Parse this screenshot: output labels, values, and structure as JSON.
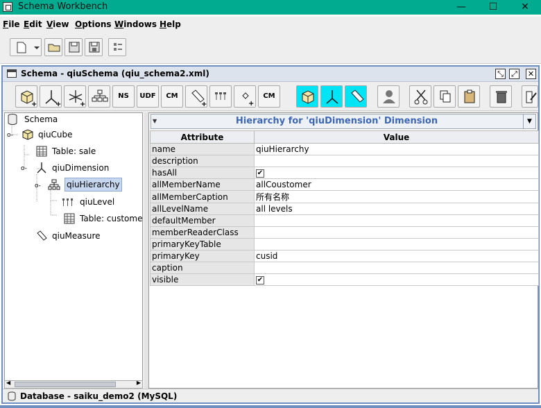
{
  "window": {
    "title": "Schema Workbench",
    "minimize": "—",
    "maximize": "☐",
    "close": "✕"
  },
  "menu": [
    {
      "first": "F",
      "rest": "ile"
    },
    {
      "first": "E",
      "rest": "dit"
    },
    {
      "first": "V",
      "rest": "iew"
    },
    {
      "first": "O",
      "rest": "ptions"
    },
    {
      "first": "W",
      "rest": "indows"
    },
    {
      "first": "H",
      "rest": "elp"
    }
  ],
  "inner_window": {
    "title": "Schema - qiuSchema (qiu_schema2.xml)"
  },
  "toolbar": {
    "buttons": [
      "cube",
      "dimension",
      "dimension-usage",
      "hierarchy",
      "NS",
      "UDF",
      "CM",
      "measure",
      "level",
      "property",
      "CM",
      "cube",
      "dimension",
      "measure",
      "role",
      "cut",
      "copy",
      "paste",
      "delete",
      "edit"
    ],
    "ns_label": "NS",
    "udf_label": "UDF",
    "cm_label": "CM",
    "cm2_label": "CM"
  },
  "tree": {
    "root": "Schema",
    "cube": "qiuCube",
    "table1": "Table: sale",
    "dimension": "qiuDimension",
    "hierarchy": "qiuHierarchy",
    "level": "qiuLevel",
    "table2": "Table: customer",
    "measure": "qiuMeasure"
  },
  "editor": {
    "heading": "Hierarchy for 'qiuDimension' Dimension",
    "col_attribute": "Attribute",
    "col_value": "Value",
    "rows": [
      {
        "attr": "name",
        "value": "qiuHierarchy"
      },
      {
        "attr": "description",
        "value": ""
      },
      {
        "attr": "hasAll",
        "value": "✔"
      },
      {
        "attr": "allMemberName",
        "value": "allCoustomer"
      },
      {
        "attr": "allMemberCaption",
        "value": "所有名称"
      },
      {
        "attr": "allLevelName",
        "value": "all levels"
      },
      {
        "attr": "defaultMember",
        "value": ""
      },
      {
        "attr": "memberReaderClass",
        "value": ""
      },
      {
        "attr": "primaryKeyTable",
        "value": ""
      },
      {
        "attr": "primaryKey",
        "value": "cusid"
      },
      {
        "attr": "caption",
        "value": ""
      },
      {
        "attr": "visible",
        "value": "✔"
      }
    ]
  },
  "status": {
    "text": "Database - saiku_demo2 (MySQL)"
  },
  "colors": {
    "titlebar": "#00ab8f",
    "accent": "#3d67b5",
    "cyan_button": "#00e5f5"
  }
}
